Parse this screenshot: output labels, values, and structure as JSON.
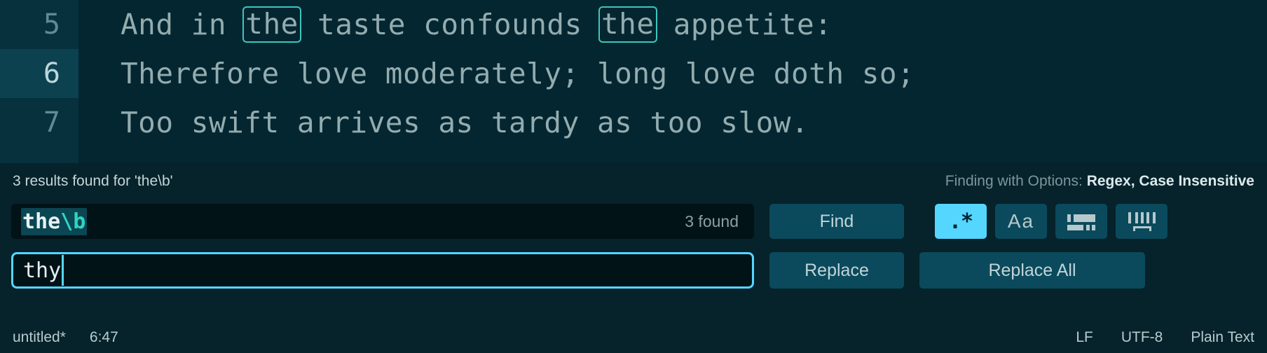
{
  "editor": {
    "lines": [
      {
        "number": "5",
        "active": false,
        "segments": [
          {
            "text": "And in ",
            "match": false
          },
          {
            "text": "the",
            "match": true
          },
          {
            "text": " taste confounds ",
            "match": false
          },
          {
            "text": "the",
            "match": true
          },
          {
            "text": " appetite:",
            "match": false
          }
        ]
      },
      {
        "number": "6",
        "active": true,
        "segments": [
          {
            "text": "Therefore love moderately; long love doth so;",
            "match": false
          }
        ]
      },
      {
        "number": "7",
        "active": false,
        "segments": [
          {
            "text": "Too swift arrives as tardy as too slow.",
            "match": false
          }
        ]
      }
    ]
  },
  "find_panel": {
    "results_text": "3 results found for 'the\\b'",
    "options_prefix": "Finding with Options: ",
    "options_value": "Regex, Case Insensitive",
    "search": {
      "value_literal": "the",
      "value_escape": "\\b",
      "found_label": "3 found"
    },
    "replace": {
      "value": "thy"
    },
    "buttons": {
      "find": "Find",
      "replace": "Replace",
      "replace_all": "Replace All"
    },
    "toggles": [
      {
        "name": "regex",
        "glyph": ".*",
        "active": true
      },
      {
        "name": "match-case",
        "glyph": "Aa",
        "active": false
      },
      {
        "name": "whole-word",
        "glyph": "",
        "active": false
      },
      {
        "name": "in-selection",
        "glyph": "",
        "active": false
      }
    ]
  },
  "statusbar": {
    "left": [
      "untitled*",
      "6:47"
    ],
    "right": [
      "LF",
      "UTF-8",
      "Plain Text"
    ]
  },
  "colors": {
    "accent": "#55d6ff",
    "match_outline": "#3ec5bd",
    "editor_bg": "#042630",
    "panel_bg": "#06222b",
    "gutter_bg": "#06313d",
    "gutter_active": "#0c4150",
    "button_bg": "#0a4a5c",
    "regex_escape": "#2fd4c3"
  }
}
